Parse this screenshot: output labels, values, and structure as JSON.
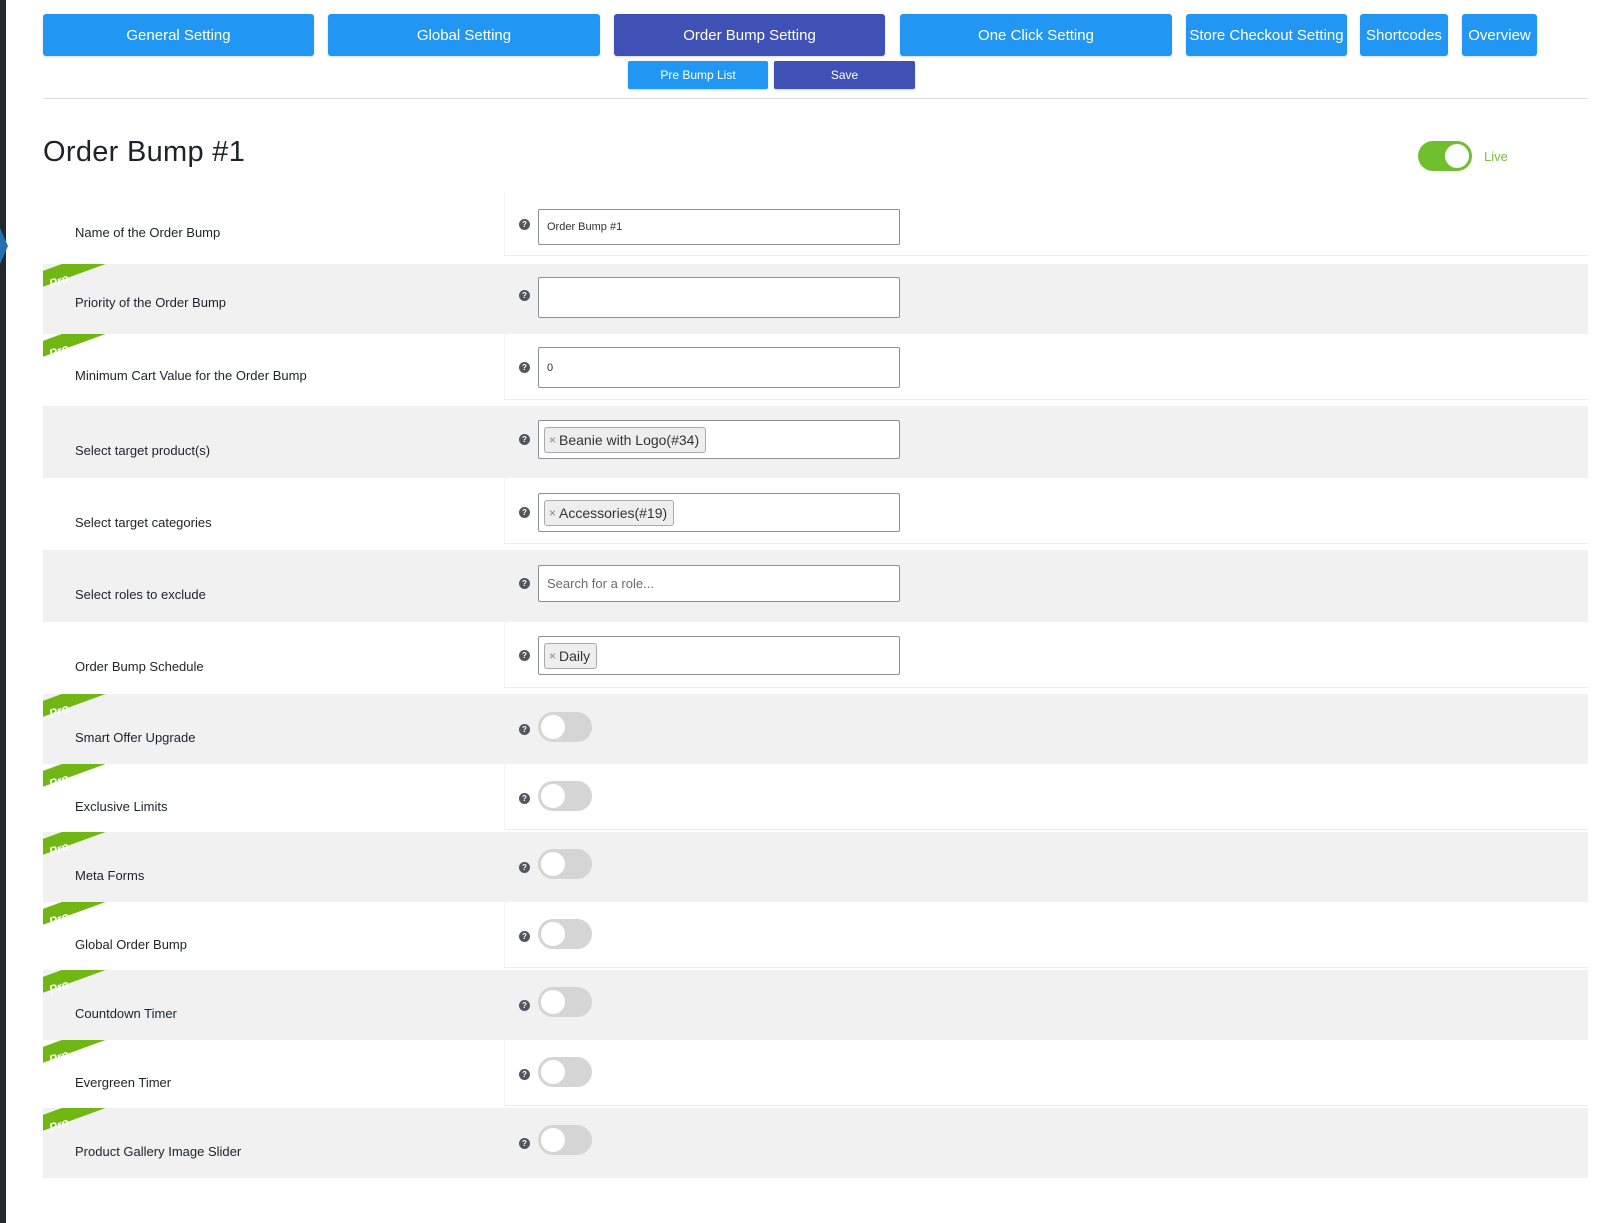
{
  "nav": {
    "tabs": [
      {
        "label": "General Setting"
      },
      {
        "label": "Global Setting"
      },
      {
        "label": "Order Bump Setting"
      },
      {
        "label": "One Click Setting"
      },
      {
        "label": "Store Checkout Setting"
      },
      {
        "label": "Shortcodes"
      },
      {
        "label": "Overview"
      }
    ],
    "pre_bump_list_label": "Pre Bump List",
    "save_label": "Save"
  },
  "page": {
    "title": "Order Bump #1",
    "status_label": "Live",
    "status_on": true
  },
  "badges": {
    "pro": "Pro",
    "help": "?"
  },
  "fields": {
    "name": {
      "label": "Name of the Order Bump",
      "value": "Order Bump #1"
    },
    "priority": {
      "label": "Priority of the Order Bump",
      "value": ""
    },
    "min_cart": {
      "label": "Minimum Cart Value for the Order Bump",
      "value": "0"
    },
    "target_products": {
      "label": "Select target product(s)",
      "tags": [
        "Beanie with Logo(#34)"
      ]
    },
    "target_categories": {
      "label": "Select target categories",
      "tags": [
        "Accessories(#19)"
      ]
    },
    "exclude_roles": {
      "label": "Select roles to exclude",
      "placeholder": "Search for a role..."
    },
    "schedule": {
      "label": "Order Bump Schedule",
      "tags": [
        "Daily"
      ]
    }
  },
  "toggles": [
    {
      "label": "Smart Offer Upgrade",
      "on": false
    },
    {
      "label": "Exclusive Limits",
      "on": false
    },
    {
      "label": "Meta Forms",
      "on": false
    },
    {
      "label": "Global Order Bump",
      "on": false
    },
    {
      "label": "Countdown Timer",
      "on": false
    },
    {
      "label": "Evergreen Timer",
      "on": false
    },
    {
      "label": "Product Gallery Image Slider",
      "on": false
    }
  ],
  "colors": {
    "tab": "#2196f3",
    "tab_active": "#3f51b5",
    "pro_ribbon": "#71b713",
    "live_toggle": "#6fbf2e"
  }
}
